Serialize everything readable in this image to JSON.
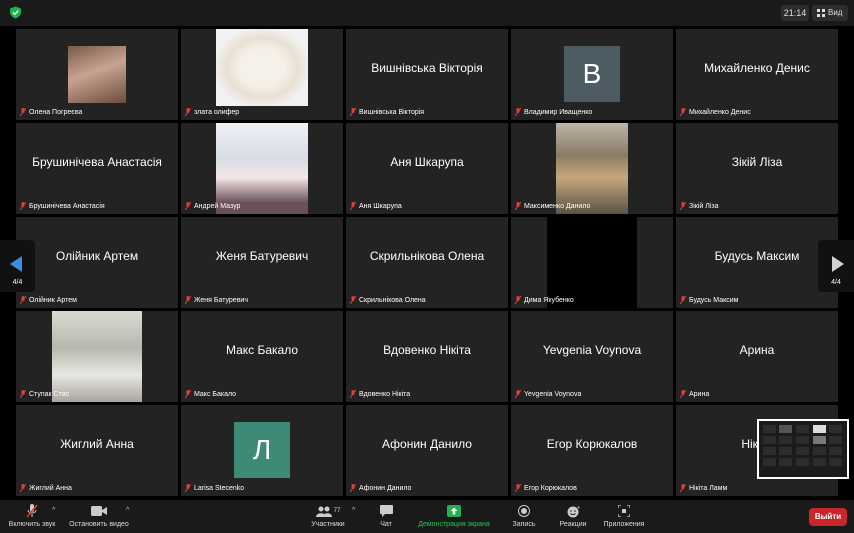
{
  "topbar": {
    "time": "21:14",
    "view_label": "Вид"
  },
  "tiles": [
    {
      "display": "",
      "label": "Олена Погреєва"
    },
    {
      "display": "",
      "label": "злата олифер"
    },
    {
      "display": "Вишнівська Вікторія",
      "label": "Вишнівська Вікторія"
    },
    {
      "display": "",
      "label": "Владимир Иващенко",
      "avatar": "В"
    },
    {
      "display": "Михайленко Денис",
      "label": "Михайленко Денис"
    },
    {
      "display": "Брушинічева Анастасія",
      "label": "Брушинічева Анастасія"
    },
    {
      "display": "",
      "label": "Андрей Мазур"
    },
    {
      "display": "Аня Шкарупа",
      "label": "Аня Шкарупа"
    },
    {
      "display": "",
      "label": "Максименко Данило"
    },
    {
      "display": "Зікій Ліза",
      "label": "Зікій Ліза"
    },
    {
      "display": "Олійник Артем",
      "label": "Олійник Артем"
    },
    {
      "display": "Женя Батуревич",
      "label": "Женя Батуревич"
    },
    {
      "display": "Скрильнікова Олена",
      "label": "Скрильнікова Олена"
    },
    {
      "display": "",
      "label": "Дима Якубенко"
    },
    {
      "display": "Будусь Максим",
      "label": "Будусь Максим"
    },
    {
      "display": "",
      "label": "Ступак Стас"
    },
    {
      "display": "Макс Бакало",
      "label": "Макс Бакало"
    },
    {
      "display": "Вдовенко Нікіта",
      "label": "Вдовенко Нікіта"
    },
    {
      "display": "Yevgenia Voynova",
      "label": "Yevgenia Voynova"
    },
    {
      "display": "Арина",
      "label": "Арина"
    },
    {
      "display": "Жиглий Анна",
      "label": "Жиглий Анна"
    },
    {
      "display": "",
      "label": "Larisa Stecenko",
      "avatar": "Л"
    },
    {
      "display": "Афонин Данило",
      "label": "Афонин Данило"
    },
    {
      "display": "Егор Корюкалов",
      "label": "Егор Корюкалов"
    },
    {
      "display": "Нікіта",
      "label": "Нікіта Ламм"
    }
  ],
  "pagination": {
    "left": "4/4",
    "right": "4/4"
  },
  "toolbar": {
    "unmute": "Включить звук",
    "video": "Остановить видео",
    "participants": "Участники",
    "participants_count": "77",
    "chat": "Чат",
    "share": "Демонстрация экрана",
    "record": "Запись",
    "reactions": "Реакции",
    "apps": "Приложения",
    "leave": "Выйти"
  },
  "colors": {
    "leave": "#c9262b",
    "share_green": "#22b14c",
    "avatar_v": "#4d5b63",
    "avatar_l": "#3d8a77"
  }
}
